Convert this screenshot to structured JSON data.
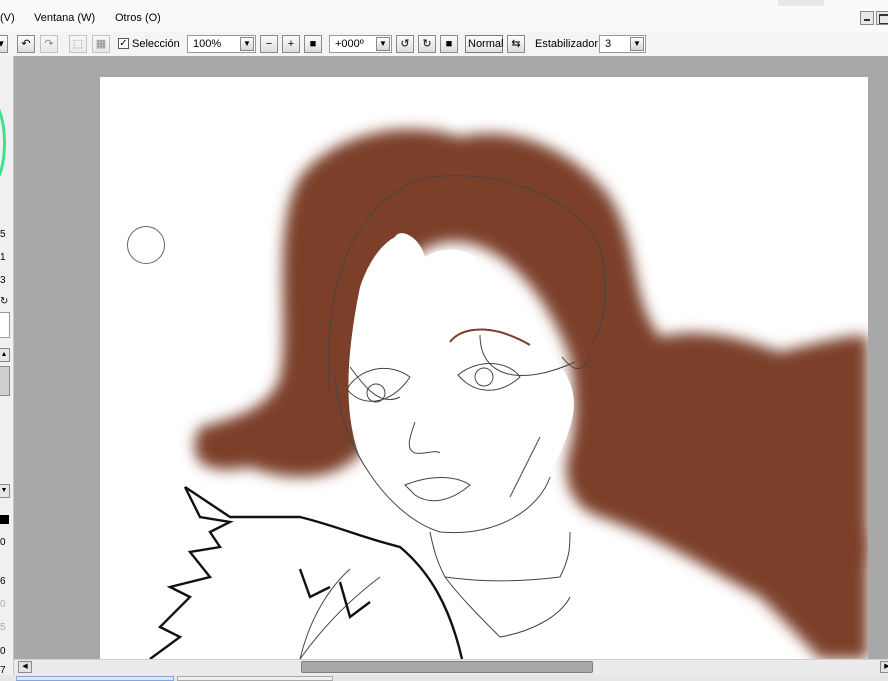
{
  "menu": {
    "ventana_prefix": "(V)",
    "ventana": "Ventana (W)",
    "otros": "Otros (O)"
  },
  "toolbar": {
    "seleccion_label": "Selección",
    "seleccion_checked": true,
    "zoom_value": "100%",
    "rotation_value": "+000º",
    "blend_mode": "Normal",
    "stabilizer_label": "Estabilizador",
    "stabilizer_value": "3"
  },
  "left_panel": {
    "values": [
      "5",
      "1",
      "3",
      "0",
      "6",
      "0",
      "5",
      "0",
      "7"
    ]
  },
  "colors": {
    "hair": "#7b3f2c",
    "canvas_bg": "#a8a8a8",
    "paper": "#ffffff"
  }
}
